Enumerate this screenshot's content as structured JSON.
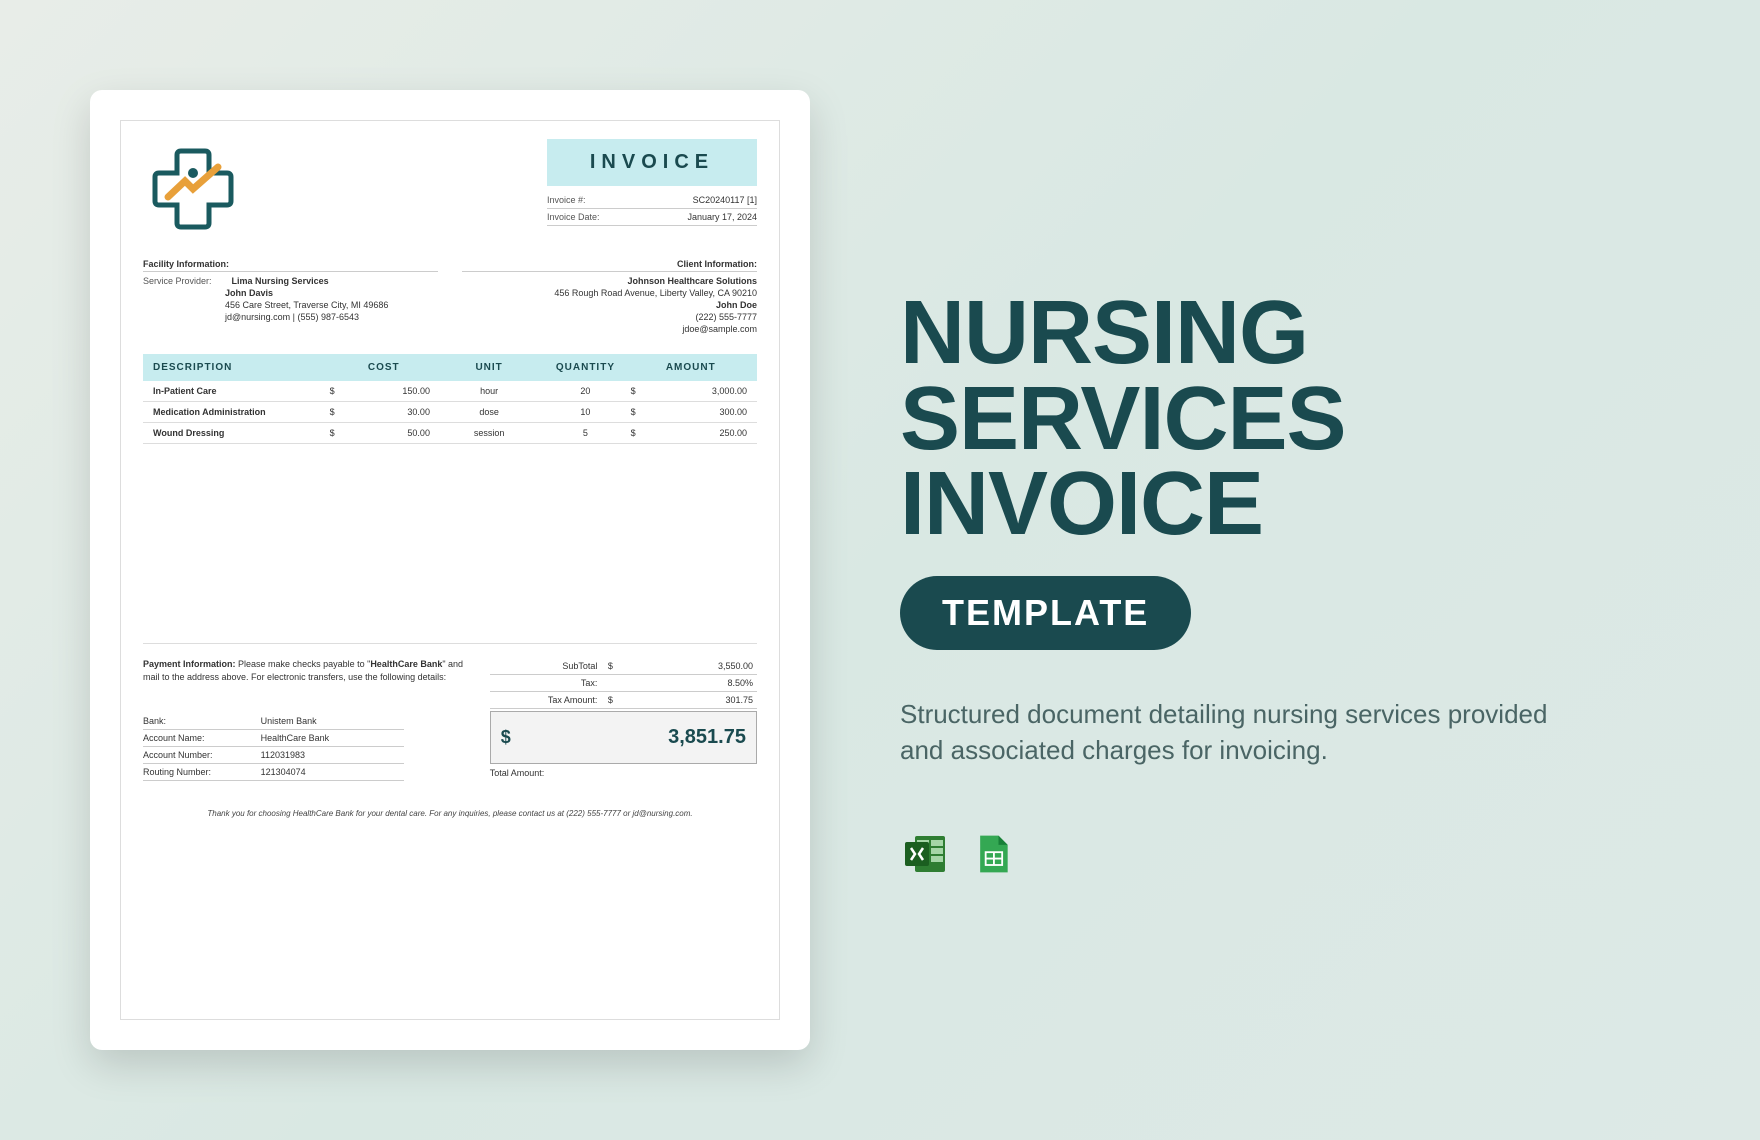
{
  "invoice": {
    "title": "INVOICE",
    "meta": {
      "invoice_number_label": "Invoice #:",
      "invoice_number": "SC20240117 [1]",
      "invoice_date_label": "Invoice Date:",
      "invoice_date": "January 17, 2024"
    },
    "facility": {
      "heading": "Facility Information:",
      "provider_label": "Service Provider:",
      "provider": "Lima Nursing Services",
      "contact_name": "John Davis",
      "address": "456 Care Street, Traverse City, MI 49686",
      "contact": "jd@nursing.com | (555) 987-6543"
    },
    "client": {
      "heading": "Client Information:",
      "company": "Johnson Healthcare Solutions",
      "address": "456 Rough Road Avenue, Liberty Valley, CA 90210",
      "contact_name": "John Doe",
      "phone": "(222) 555-7777",
      "email": "jdoe@sample.com"
    },
    "columns": {
      "description": "DESCRIPTION",
      "cost": "COST",
      "unit": "UNIT",
      "quantity": "QUANTITY",
      "amount": "AMOUNT"
    },
    "items": [
      {
        "description": "In-Patient Care",
        "cost": "150.00",
        "unit": "hour",
        "quantity": "20",
        "amount": "3,000.00"
      },
      {
        "description": "Medication Administration",
        "cost": "30.00",
        "unit": "dose",
        "quantity": "10",
        "amount": "300.00"
      },
      {
        "description": "Wound Dressing",
        "cost": "50.00",
        "unit": "session",
        "quantity": "5",
        "amount": "250.00"
      }
    ],
    "currency": "$",
    "payment": {
      "heading": "Payment Information:",
      "text_1": "Please make checks payable to \"",
      "payee": "HealthCare Bank",
      "text_2": "\" and mail to the address above. For electronic transfers, use the following details:",
      "bank_label": "Bank:",
      "bank": "Unistem Bank",
      "account_name_label": "Account Name:",
      "account_name": "HealthCare Bank",
      "account_number_label": "Account Number:",
      "account_number": "112031983",
      "routing_number_label": "Routing Number:",
      "routing_number": "121304074"
    },
    "totals": {
      "subtotal_label": "SubTotal",
      "subtotal": "3,550.00",
      "tax_label": "Tax:",
      "tax": "8.50%",
      "tax_amount_label": "Tax Amount:",
      "tax_amount": "301.75",
      "grand_total": "3,851.75",
      "grand_total_label": "Total Amount:"
    },
    "footer": "Thank you for choosing HealthCare Bank for your dental care. For any inquiries, please contact us at (222) 555-7777 or jd@nursing.com."
  },
  "promo": {
    "headline_1": "NURSING",
    "headline_2": "SERVICES",
    "headline_3": "INVOICE",
    "badge": "TEMPLATE",
    "description": "Structured document detailing nursing services provided and associated charges for invoicing."
  }
}
